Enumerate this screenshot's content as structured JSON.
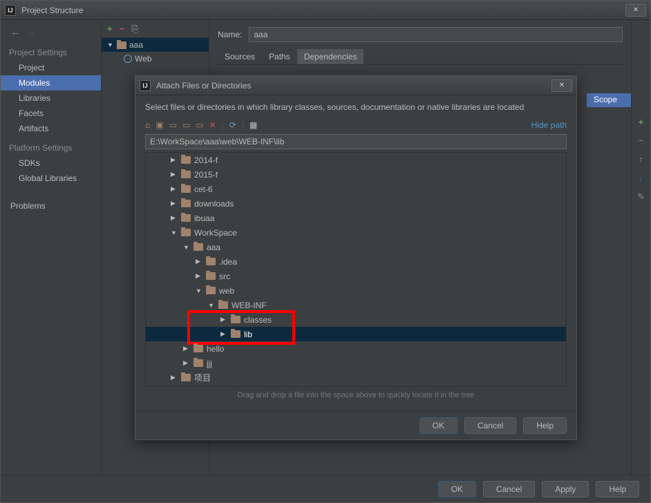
{
  "window_title": "Project Structure",
  "sidebar": {
    "heading1": "Project Settings",
    "items1": [
      "Project",
      "Modules",
      "Libraries",
      "Facets",
      "Artifacts"
    ],
    "heading2": "Platform Settings",
    "items2": [
      "SDKs",
      "Global Libraries"
    ],
    "problems": "Problems"
  },
  "module_tree": {
    "root": "aaa",
    "child": "Web"
  },
  "detail": {
    "name_label": "Name:",
    "name_value": "aaa",
    "tabs": [
      "Sources",
      "Paths",
      "Dependencies"
    ],
    "scope": "Scope"
  },
  "main_buttons": {
    "ok": "OK",
    "cancel": "Cancel",
    "apply": "Apply",
    "help": "Help"
  },
  "modal": {
    "title": "Attach Files or Directories",
    "instruct": "Select files or directories in which library classes, sources, documentation or native libraries are located",
    "hide_path": "Hide path",
    "path": "E:\\WorkSpace\\aaa\\web\\WEB-INF\\lib",
    "tree": [
      {
        "label": "2014-f",
        "indent": 2,
        "open": false
      },
      {
        "label": "2015-f",
        "indent": 2,
        "open": false
      },
      {
        "label": "cet-6",
        "indent": 2,
        "open": false
      },
      {
        "label": "downloads",
        "indent": 2,
        "open": false
      },
      {
        "label": "ibuaa",
        "indent": 2,
        "open": false
      },
      {
        "label": "WorkSpace",
        "indent": 2,
        "open": true
      },
      {
        "label": "aaa",
        "indent": 3,
        "open": true
      },
      {
        "label": ".idea",
        "indent": 4,
        "open": false
      },
      {
        "label": "src",
        "indent": 4,
        "open": false
      },
      {
        "label": "web",
        "indent": 4,
        "open": true
      },
      {
        "label": "WEB-INF",
        "indent": 5,
        "open": true
      },
      {
        "label": "classes",
        "indent": 6,
        "open": false
      },
      {
        "label": "lib",
        "indent": 6,
        "open": false,
        "selected": true
      },
      {
        "label": "hello",
        "indent": 3,
        "open": false
      },
      {
        "label": "jjj",
        "indent": 3,
        "open": false
      },
      {
        "label": "项目",
        "indent": 2,
        "open": false
      }
    ],
    "drop_hint": "Drag and drop a file into the space above to quickly locate it in the tree",
    "buttons": {
      "ok": "OK",
      "cancel": "Cancel",
      "help": "Help"
    }
  }
}
